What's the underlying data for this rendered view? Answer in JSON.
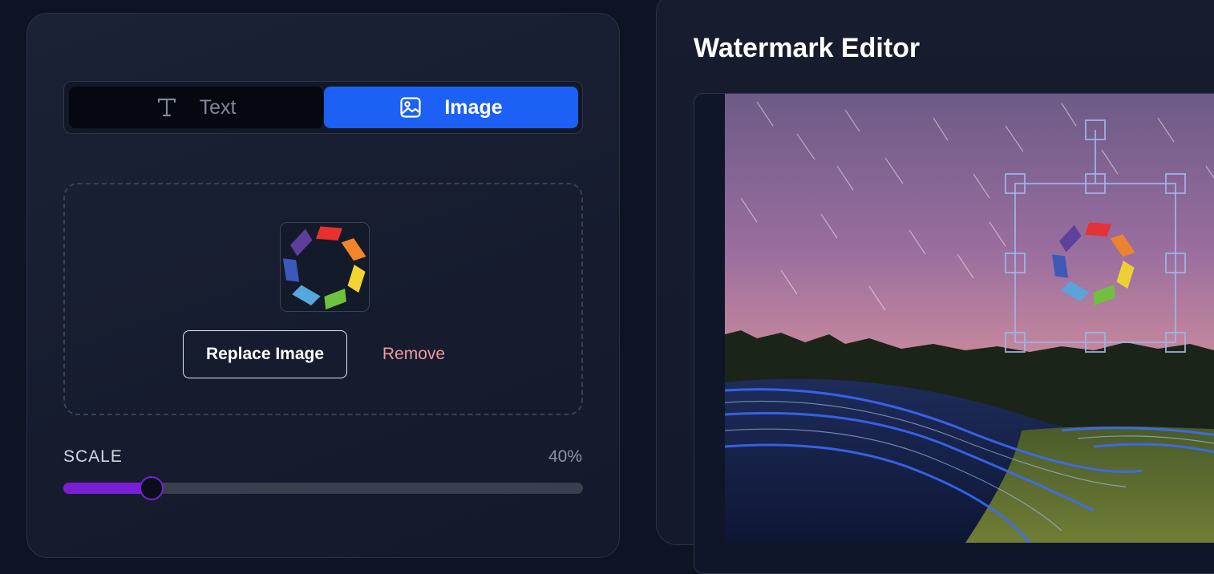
{
  "mode_toggle": {
    "text_label": "Text",
    "image_label": "Image",
    "active": "image"
  },
  "upload": {
    "replace_label": "Replace Image",
    "remove_label": "Remove"
  },
  "scale": {
    "label": "SCALE",
    "value_text": "40%",
    "value_percent": 17
  },
  "editor": {
    "title": "Watermark Editor"
  },
  "colors": {
    "accent_blue": "#1c60f6",
    "slider_purple": "#7b1fd6",
    "remove_red": "#f09a9e"
  },
  "icons": {
    "text_tab": "text-type-icon",
    "image_tab": "image-icon"
  }
}
